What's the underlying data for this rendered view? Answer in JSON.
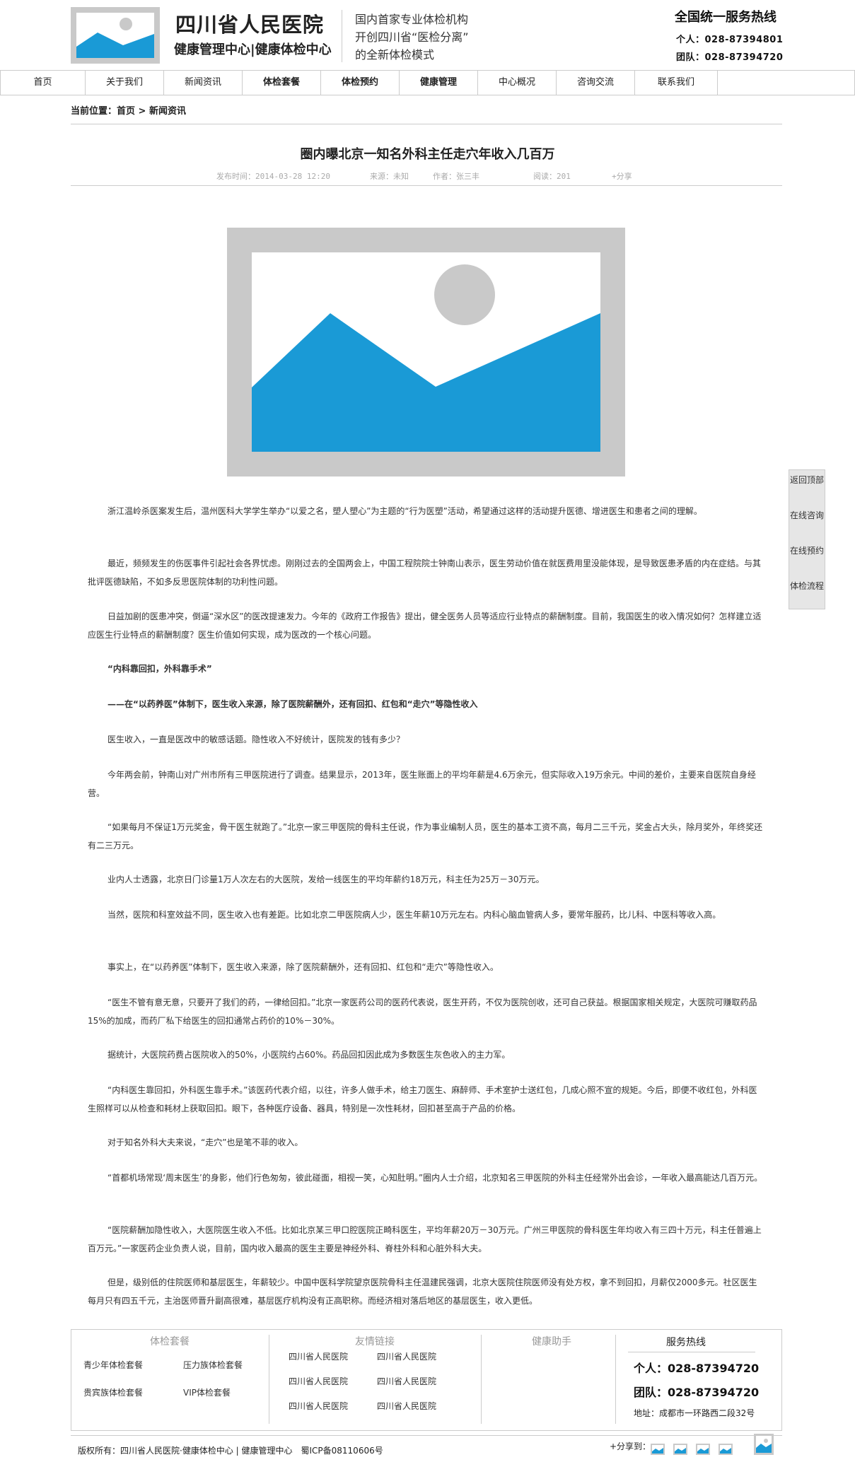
{
  "header": {
    "brand_title": "四川省人民医院",
    "brand_sub": "健康管理中心|健康体检中心",
    "slogan": [
      "国内首家专业体检机构",
      "开创四川省“医检分离”",
      "的全新体检模式"
    ],
    "hotline_title": "全国统一服务热线",
    "hotlines": [
      "个人：028-87394801",
      "团队：028-87394720"
    ]
  },
  "nav": [
    "首页",
    "关于我们",
    "新闻资讯",
    "体检套餐",
    "体检预约",
    "健康管理",
    "中心概况",
    "咨询交流",
    "联系我们"
  ],
  "breadcrumb": "当前位置：首页 > 新闻资讯",
  "article": {
    "title": "圈内曝北京一知名外科主任走穴年收入几百万",
    "publish_time": "发布时间：2014-03-28 12:20",
    "source": "来源：未知",
    "author": "作者：张三丰",
    "reads": "阅读：201",
    "share": "+分享",
    "paragraphs": [
      {
        "text": "浙江温岭杀医案发生后，温州医科大学学生举办“以爱之名，塑人塑心”为主题的“行为医塑”活动，希望通过这样的活动提升医德、增进医生和患者之间的理解。",
        "bold": false
      },
      {
        "text": "最近，频频发生的伤医事件引起社会各界忧虑。刚刚过去的全国两会上，中国工程院院士钟南山表示，医生劳动价值在就医费用里没能体现，是导致医患矛盾的内在症结。与其批评医德缺陷，不如多反思医院体制的功利性问题。",
        "bold": false
      },
      {
        "text": "日益加剧的医患冲突，倒逼“深水区”的医改提速发力。今年的《政府工作报告》提出，健全医务人员等适应行业特点的薪酬制度。目前，我国医生的收入情况如何？怎样建立适应医生行业特点的薪酬制度？医生价值如何实现，成为医改的一个核心问题。",
        "bold": false
      },
      {
        "text": "“内科靠回扣，外科靠手术”",
        "bold": true
      },
      {
        "text": "——在“以药养医”体制下，医生收入来源，除了医院薪酬外，还有回扣、红包和“走穴”等隐性收入",
        "bold": true
      },
      {
        "text": "医生收入，一直是医改中的敏感话题。隐性收入不好统计，医院发的钱有多少？",
        "bold": false
      },
      {
        "text": "今年两会前，钟南山对广州市所有三甲医院进行了调查。结果显示，2013年，医生账面上的平均年薪是4.6万余元，但实际收入19万余元。中间的差价，主要来自医院自身经营。",
        "bold": false
      },
      {
        "text": "“如果每月不保证1万元奖金，骨干医生就跑了。”北京一家三甲医院的骨科主任说，作为事业编制人员，医生的基本工资不高，每月二三千元，奖金占大头，除月奖外，年终奖还有二三万元。",
        "bold": false
      },
      {
        "text": "业内人士透露，北京日门诊量1万人次左右的大医院，发给一线医生的平均年薪约18万元，科主任为25万－30万元。",
        "bold": false
      },
      {
        "text": "当然，医院和科室效益不同，医生收入也有差距。比如北京二甲医院病人少，医生年薪10万元左右。内科心脑血管病人多，要常年服药，比儿科、中医科等收入高。",
        "bold": false
      },
      {
        "text": "事实上，在“以药养医”体制下，医生收入来源，除了医院薪酬外，还有回扣、红包和“走穴”等隐性收入。",
        "bold": false
      },
      {
        "text": "“医生不管有意无意，只要开了我们的药，一律给回扣。”北京一家医药公司的医药代表说，医生开药，不仅为医院创收，还可自己获益。根据国家相关规定，大医院可赚取药品15%的加成，而药厂私下给医生的回扣通常占药价的10%－30%。",
        "bold": false
      },
      {
        "text": "据统计，大医院药费占医院收入的50%，小医院约占60%。药品回扣因此成为多数医生灰色收入的主力军。",
        "bold": false
      },
      {
        "text": "“内科医生靠回扣，外科医生靠手术。”该医药代表介绍，以往，许多人做手术，给主刀医生、麻醉师、手术室护士送红包，几成心照不宣的规矩。今后，即便不收红包，外科医生照样可以从检查和耗材上获取回扣。眼下，各种医疗设备、器具，特别是一次性耗材，回扣甚至高于产品的价格。",
        "bold": false
      },
      {
        "text": "对于知名外科大夫来说，“走穴”也是笔不菲的收入。",
        "bold": false
      },
      {
        "text": "“首都机场常现‘周末医生’的身影，他们行色匆匆，彼此碰面，相视一笑，心知肚明。”圈内人士介绍，北京知名三甲医院的外科主任经常外出会诊，一年收入最高能达几百万元。",
        "bold": false
      },
      {
        "text": "“医院薪酬加隐性收入，大医院医生收入不低。比如北京某三甲口腔医院正畸科医生，平均年薪20万－30万元。广州三甲医院的骨科医生年均收入有三四十万元，科主任普遍上百万元。”一家医药企业负责人说，目前，国内收入最高的医生主要是神经外科、脊柱外科和心脏外科大夫。",
        "bold": false
      },
      {
        "text": "但是，级别低的住院医师和基层医生，年薪较少。中国中医科学院望京医院骨科主任温建民强调，北京大医院住院医师没有处方权，拿不到回扣，月薪仅2000多元。社区医生每月只有四五千元，主治医师晋升副高很难，基层医疗机构没有正高职称。而经济相对落后地区的基层医生，收入更低。",
        "bold": false
      }
    ]
  },
  "side": [
    "返回顶部",
    "在线咨询",
    "在线预约",
    "体检流程"
  ],
  "footer": {
    "packages_title": "体检套餐",
    "packages": [
      "青少年体检套餐",
      "压力族体检套餐",
      "贵宾族体检套餐",
      "VIP体检套餐"
    ],
    "links_title": "友情链接",
    "links": [
      "四川省人民医院",
      "四川省人民医院",
      "四川省人民医院",
      "四川省人民医院",
      "四川省人民医院",
      "四川省人民医院"
    ],
    "assistant_title": "健康助手",
    "service_title": "服务热线",
    "service_personal": "个人：028-87394720",
    "service_team": "团队：028-87394720",
    "address": "地址：成都市一环路西二段32号",
    "copyright": "版权所有：四川省人民医院·健康体检中心 | 健康管理中心　蜀ICP备08110606号",
    "share_label": "+分享到："
  },
  "colors": {
    "accent_blue": "#1a9ad6",
    "placeholder_gray": "#c9c9c9",
    "border": "#cccccc"
  }
}
